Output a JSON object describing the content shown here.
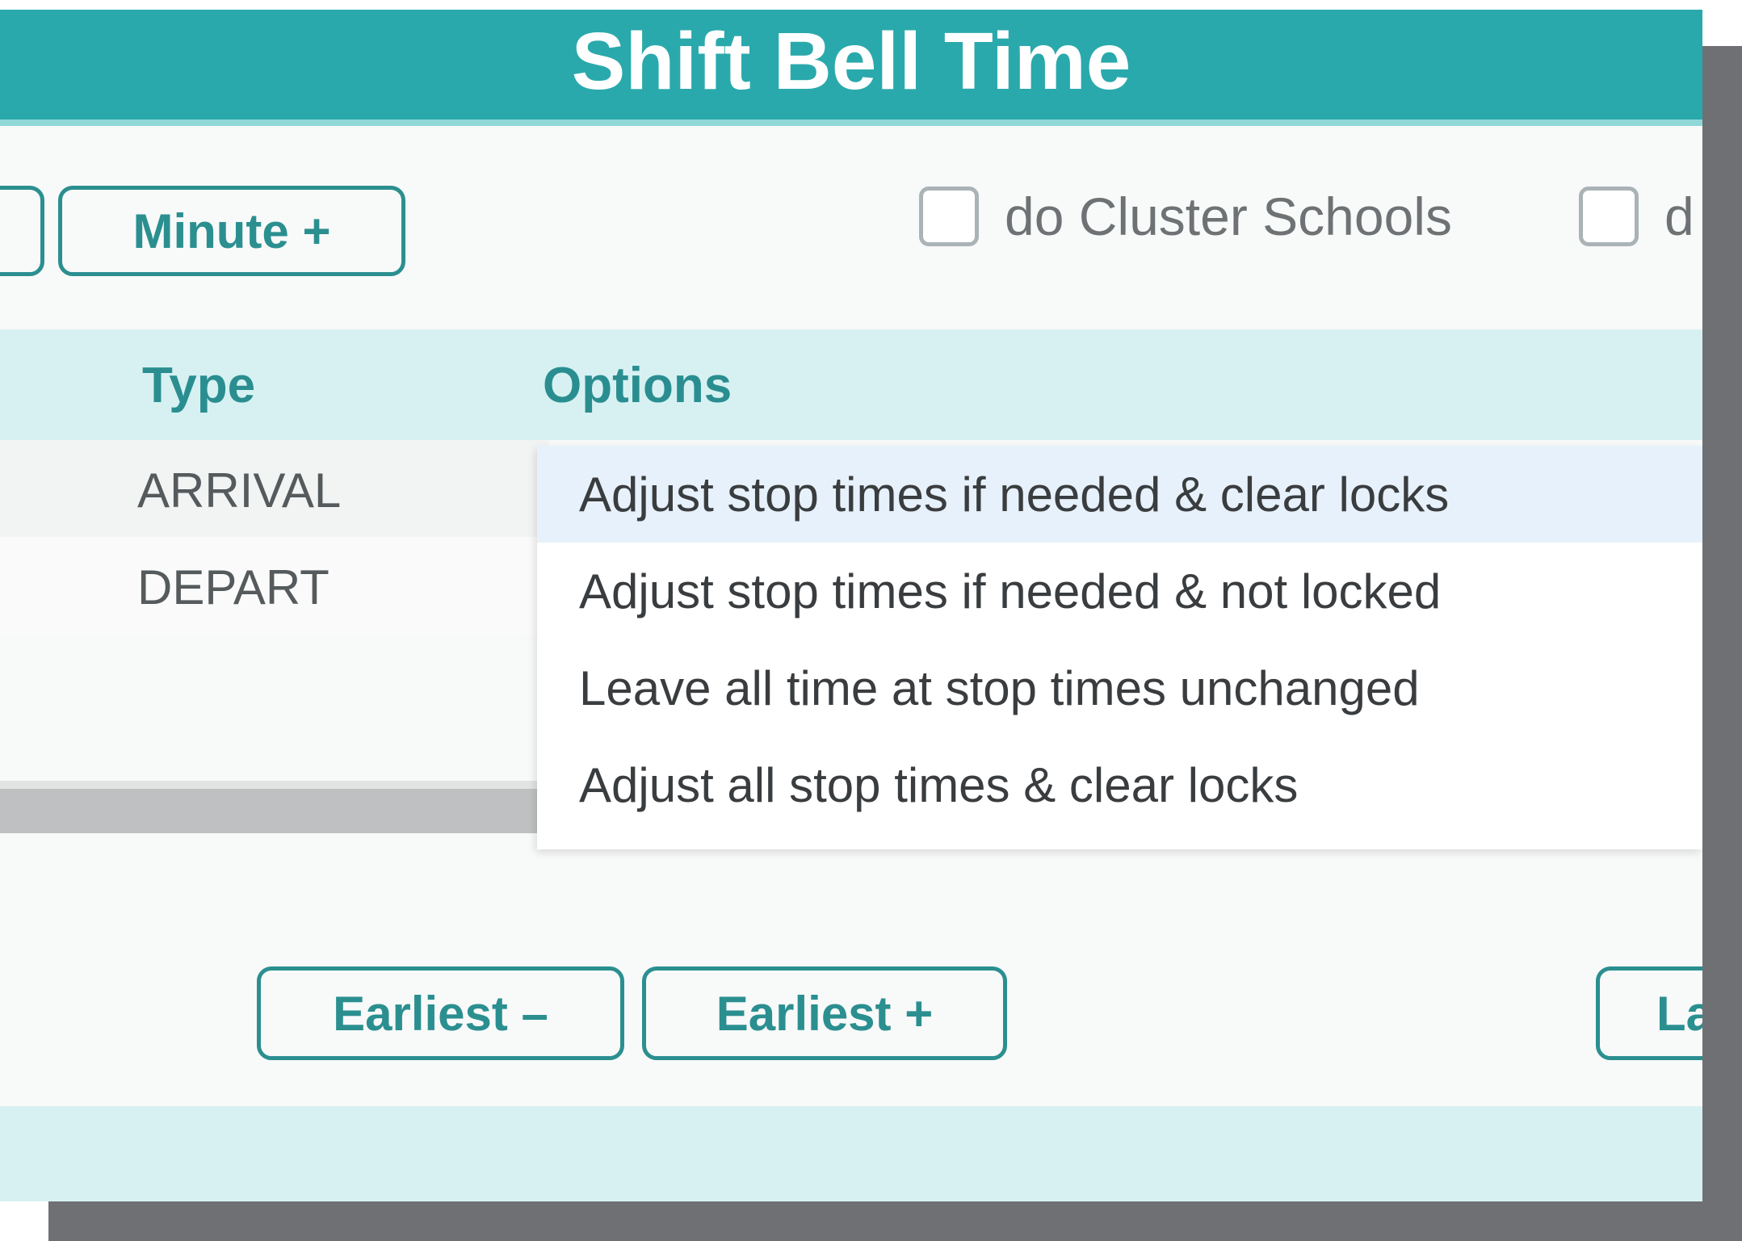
{
  "dialog": {
    "title": "Shift Bell Time"
  },
  "toolbar": {
    "minute_plus_label": "Minute +",
    "cluster_checkbox_label": "do Cluster Schools",
    "partial_checkbox_label": "d"
  },
  "table": {
    "headers": {
      "type": "Type",
      "options": "Options"
    },
    "rows": [
      {
        "type": "ARRIVAL"
      },
      {
        "type": "DEPART"
      }
    ]
  },
  "options_dropdown": {
    "items": [
      "Adjust stop times if needed & clear locks",
      "Adjust stop times if needed & not locked",
      "Leave all time at stop times unchanged",
      "Adjust all stop times & clear locks"
    ],
    "selected_index": 0
  },
  "footer": {
    "earliest_minus_label": "Earliest –",
    "earliest_plus_label": "Earliest +",
    "partial_button_label": "La"
  },
  "colors": {
    "accent": "#2aa9ac",
    "header_bg": "#d7f1f2",
    "button_border": "#2b8f90"
  }
}
